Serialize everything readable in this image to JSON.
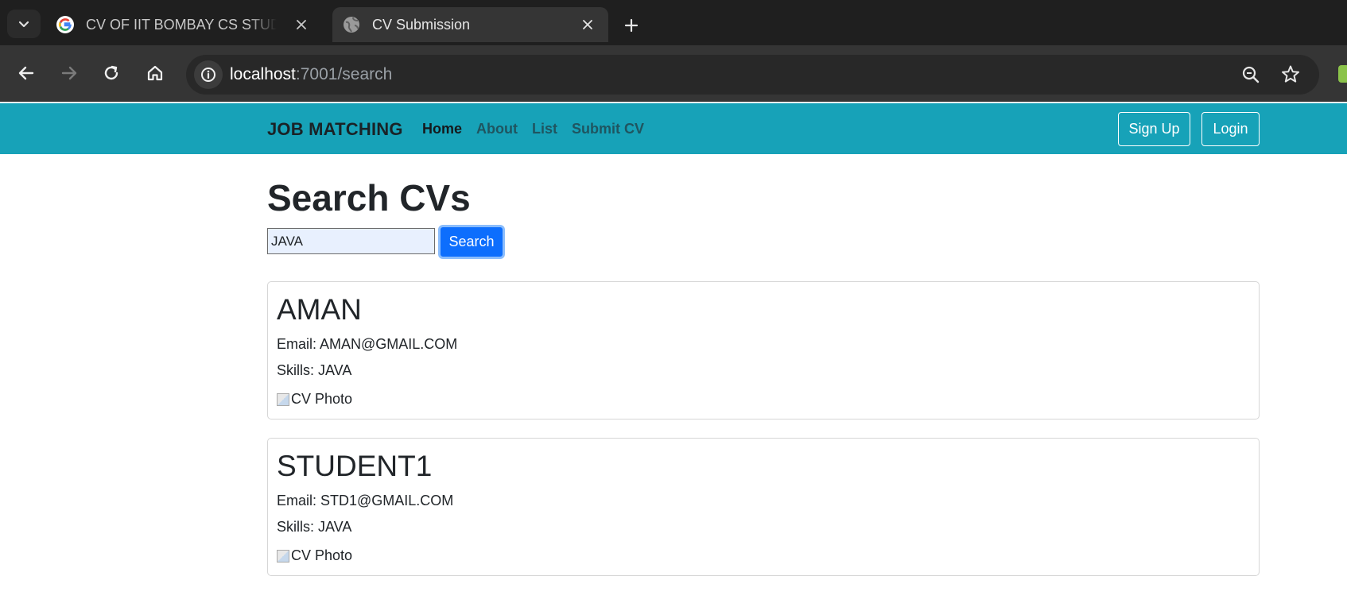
{
  "browser": {
    "tabs": [
      {
        "title": "CV OF IIT BOMBAY CS STUDENT",
        "active": false,
        "favicon": "google-g-icon"
      },
      {
        "title": "CV Submission",
        "active": true,
        "favicon": "globe-icon"
      }
    ],
    "url_host": "localhost",
    "url_rest": ":7001/search"
  },
  "navbar": {
    "brand": "JOB MATCHING",
    "links": [
      {
        "label": "Home",
        "active": true
      },
      {
        "label": "About",
        "active": false
      },
      {
        "label": "List",
        "active": false
      },
      {
        "label": "Submit CV",
        "active": false
      }
    ],
    "signup_label": "Sign Up",
    "login_label": "Login",
    "bg_color": "#17a2b8"
  },
  "main": {
    "title": "Search CVs",
    "search_value": "JAVA",
    "search_button_label": "Search",
    "results": [
      {
        "name": "AMAN",
        "email": "Email: AMAN@GMAIL.COM",
        "skills": "Skills: JAVA",
        "photo_alt": "CV Photo"
      },
      {
        "name": "STUDENT1",
        "email": "Email: STD1@GMAIL.COM",
        "skills": "Skills: JAVA",
        "photo_alt": "CV Photo"
      }
    ]
  }
}
